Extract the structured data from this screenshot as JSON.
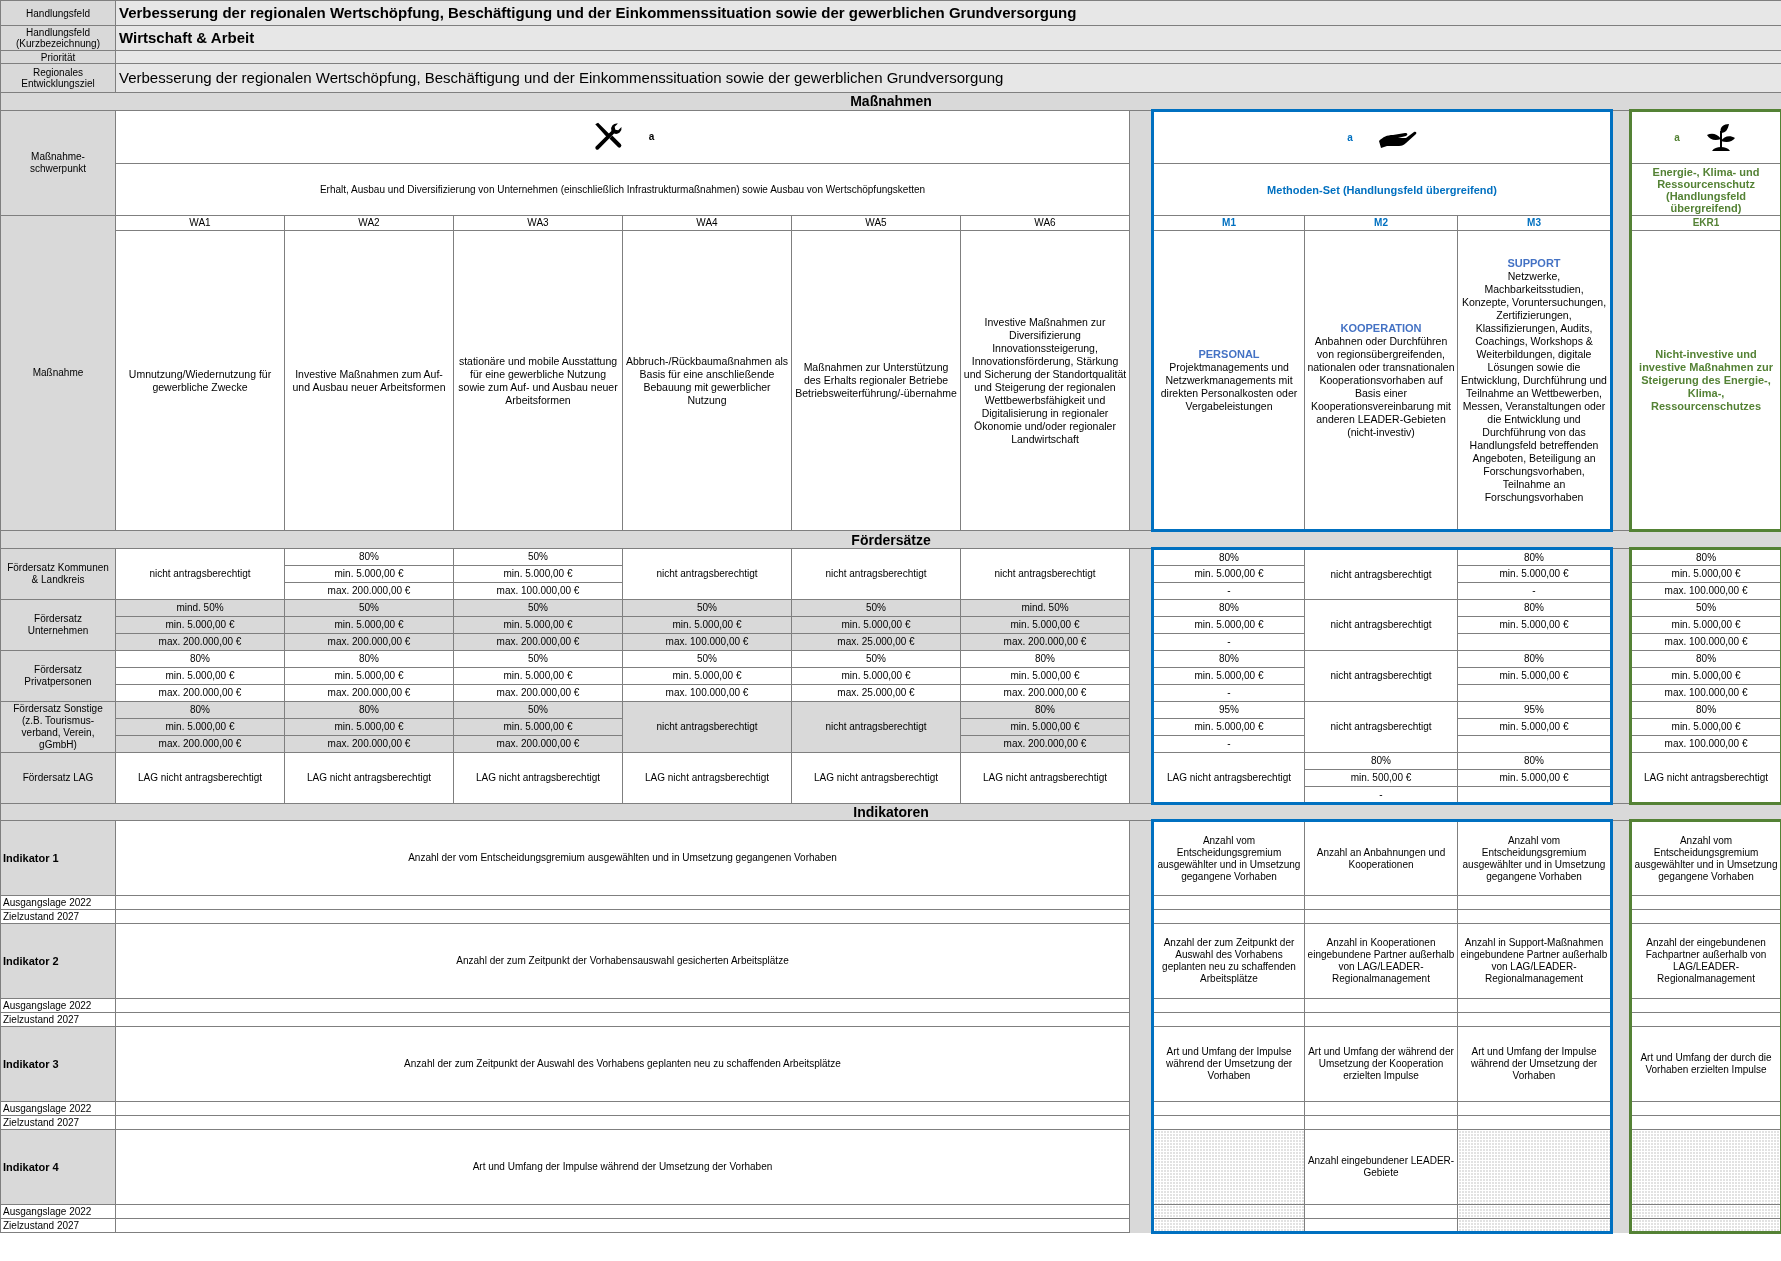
{
  "header": [
    {
      "label": "Handlungsfeld",
      "value": "Verbesserung der regionalen Wertschöpfung, Beschäftigung und der Einkommenssituation sowie der gewerblichen Grundversorgung",
      "bold": true
    },
    {
      "label": "Handlungsfeld (Kurzbezeichnung)",
      "value": "Wirtschaft & Arbeit",
      "bold": true
    },
    {
      "label": "Priorität"
    },
    {
      "label": "Regionales Entwicklungsziel",
      "value": "Verbesserung der regionalen Wertschöpfung, Beschäftigung und der Einkommenssituation sowie der gewerblichen Grundversorgung",
      "bold": false
    }
  ],
  "measures_section": {
    "title": "Maßnahmen",
    "focus_label": "Maßnahme-schwerpunkt",
    "measure_label": "Maßnahme",
    "groups": [
      {
        "kind": "main",
        "color": "#000000",
        "note": "a",
        "title": "Erhalt, Ausbau und Diversifizierung von Unternehmen (einschließlich Infrastrukturmaßnahmen) sowie Ausbau von Wertschöpfungsketten",
        "measures": [
          {
            "code": "WA1",
            "text": "Umnutzung/Wiedernutzung für gewerbliche Zwecke"
          },
          {
            "code": "WA2",
            "text": "Investive Maßnahmen zum Auf- und Ausbau neuer Arbeitsformen"
          },
          {
            "code": "WA3",
            "text": "stationäre und mobile Ausstattung für eine gewerbliche Nutzung sowie zum Auf- und Ausbau neuer Arbeitsformen"
          },
          {
            "code": "WA4",
            "text": "Abbruch-/Rückbaumaßnahmen als Basis für eine anschließende Bebauung mit gewerblicher Nutzung"
          },
          {
            "code": "WA5",
            "text": "Maßnahmen zur Unterstützung des Erhalts regionaler Betriebe Betriebsweiterführung/-übernahme"
          },
          {
            "code": "WA6",
            "text": "Investive Maßnahmen zur Diversifizierung Innovationssteigerung, Innovationsförderung, Stärkung und Sicherung der Standortqualität und Steigerung der regionalen Wettbewerbsfähigkeit und Digitalisierung in regionaler Ökonomie und/oder regionaler Landwirtschaft"
          }
        ]
      },
      {
        "kind": "methods",
        "color": "#0070c0",
        "note": "a",
        "title": "Methoden-Set (Handlungsfeld übergreifend)",
        "measures": [
          {
            "code": "M1",
            "heading": "PERSONAL",
            "text": "Projektmanagements und Netzwerkmanagements mit direkten Personalkosten oder Vergabeleistungen"
          },
          {
            "code": "M2",
            "heading": "KOOPERATION",
            "text": "Anbahnen oder Durchführen von regionsübergreifenden, nationalen oder transnationalen Kooperationsvorhaben auf Basis einer Kooperationsvereinbarung mit anderen LEADER-Gebieten (nicht-investiv)"
          },
          {
            "code": "M3",
            "heading": "SUPPORT",
            "text": "Netzwerke, Machbarkeitsstudien, Konzepte, Voruntersuchungen, Zertifizierungen, Klassifizierungen, Audits, Coachings, Workshops & Weiterbildungen, digitale Lösungen sowie die Entwicklung, Durchführung und Teilnahme an Wettbewerben, Messen, Veranstaltungen oder die Entwicklung und Durchführung von das Handlungsfeld betreffenden Angeboten, Beteiligung an Forschungsvorhaben, Teilnahme an Forschungsvorhaben"
          }
        ]
      },
      {
        "kind": "climate",
        "color": "#548235",
        "note": "a",
        "title": "Energie-, Klima- und Ressourcenschutz (Handlungsfeld übergreifend)",
        "measures": [
          {
            "code": "EKR1",
            "text": "Nicht-investive und investive Maßnahmen zur Steigerung des Energie-, Klima-, Ressourcenschutzes"
          }
        ]
      }
    ]
  },
  "funding": {
    "title": "Fördersätze",
    "rows": [
      {
        "label": "Fördersatz Kommunen & Landkreis",
        "shaded": false,
        "cells": [
          {
            "text": "nicht antragsberechtigt"
          },
          {
            "lines": [
              "80%",
              "min. 5.000,00 €",
              "max. 200.000,00 €"
            ]
          },
          {
            "lines": [
              "50%",
              "min. 5.000,00 €",
              "max. 100.000,00 €"
            ]
          },
          {
            "text": "nicht antragsberechtigt"
          },
          {
            "text": "nicht antragsberechtigt"
          },
          {
            "text": "nicht antragsberechtigt"
          },
          {
            "lines": [
              "80%",
              "min. 5.000,00 €",
              "-"
            ]
          },
          {
            "text": "nicht antragsberechtigt"
          },
          {
            "lines": [
              "80%",
              "min. 5.000,00 €",
              "-"
            ]
          },
          {
            "lines": [
              "80%",
              "min. 5.000,00 €",
              "max. 100.000,00 €"
            ]
          }
        ]
      },
      {
        "label": "Fördersatz Unternehmen",
        "shaded": true,
        "cells": [
          {
            "lines": [
              "mind. 50%",
              "min. 5.000,00 €",
              "max. 200.000,00 €"
            ]
          },
          {
            "lines": [
              "50%",
              "min. 5.000,00 €",
              "max. 200.000,00 €"
            ]
          },
          {
            "lines": [
              "50%",
              "min. 5.000,00 €",
              "max. 200.000,00 €"
            ]
          },
          {
            "lines": [
              "50%",
              "min. 5.000,00 €",
              "max. 100.000,00 €"
            ]
          },
          {
            "lines": [
              "50%",
              "min. 5.000,00 €",
              "max. 25.000,00 €"
            ]
          },
          {
            "lines": [
              "mind. 50%",
              "min. 5.000,00 €",
              "max. 200.000,00 €"
            ]
          },
          {
            "lines": [
              "80%",
              "min. 5.000,00 €",
              "-"
            ]
          },
          {
            "text": "nicht antragsberechtigt"
          },
          {
            "lines": [
              "80%",
              "min. 5.000,00 €"
            ]
          },
          {
            "lines": [
              "50%",
              "min. 5.000,00 €",
              "max. 100.000,00 €"
            ]
          }
        ]
      },
      {
        "label": "Fördersatz Privatpersonen",
        "shaded": false,
        "cells": [
          {
            "lines": [
              "80%",
              "min. 5.000,00 €",
              "max. 200.000,00 €"
            ]
          },
          {
            "lines": [
              "80%",
              "min. 5.000,00 €",
              "max. 200.000,00 €"
            ]
          },
          {
            "lines": [
              "50%",
              "min. 5.000,00 €",
              "max. 200.000,00 €"
            ]
          },
          {
            "lines": [
              "50%",
              "min. 5.000,00 €",
              "max. 100.000,00 €"
            ]
          },
          {
            "lines": [
              "50%",
              "min. 5.000,00 €",
              "max. 25.000,00 €"
            ]
          },
          {
            "lines": [
              "80%",
              "min. 5.000,00 €",
              "max. 200.000,00 €"
            ]
          },
          {
            "lines": [
              "80%",
              "min. 5.000,00 €",
              "-"
            ]
          },
          {
            "text": "nicht antragsberechtigt"
          },
          {
            "lines": [
              "80%",
              "min. 5.000,00 €"
            ]
          },
          {
            "lines": [
              "80%",
              "min. 5.000,00 €",
              "max. 100.000,00 €"
            ]
          }
        ]
      },
      {
        "label": "Fördersatz Sonstige (z.B. Tourismus-verband, Verein, gGmbH)",
        "shaded": true,
        "cells": [
          {
            "lines": [
              "80%",
              "min. 5.000,00 €",
              "max. 200.000,00 €"
            ]
          },
          {
            "lines": [
              "80%",
              "min. 5.000,00 €",
              "max. 200.000,00 €"
            ]
          },
          {
            "lines": [
              "50%",
              "min. 5.000,00 €",
              "max. 200.000,00 €"
            ]
          },
          {
            "text": "nicht antragsberechtigt"
          },
          {
            "text": "nicht antragsberechtigt"
          },
          {
            "lines": [
              "80%",
              "min. 5.000,00 €",
              "max. 200.000,00 €"
            ]
          },
          {
            "lines": [
              "95%",
              "min. 5.000,00 €",
              "-"
            ]
          },
          {
            "text": "nicht antragsberechtigt"
          },
          {
            "lines": [
              "95%",
              "min. 5.000,00 €"
            ]
          },
          {
            "lines": [
              "80%",
              "min. 5.000,00 €",
              "max. 100.000,00 €"
            ]
          }
        ]
      },
      {
        "label": "Fördersatz LAG",
        "shaded": false,
        "cells": [
          {
            "text": "LAG nicht antragsberechtigt"
          },
          {
            "text": "LAG nicht antragsberechtigt"
          },
          {
            "text": "LAG nicht antragsberechtigt"
          },
          {
            "text": "LAG nicht antragsberechtigt"
          },
          {
            "text": "LAG nicht antragsberechtigt"
          },
          {
            "text": "LAG nicht antragsberechtigt"
          },
          {
            "text": "LAG nicht antragsberechtigt"
          },
          {
            "lines": [
              "80%",
              "min. 500,00 €",
              "-"
            ]
          },
          {
            "lines": [
              "80%",
              "min. 5.000,00 €"
            ]
          },
          {
            "text": "LAG nicht antragsberechtigt"
          }
        ]
      }
    ]
  },
  "indicators": {
    "title": "Indikatoren",
    "items": [
      {
        "label": "Indikator 1",
        "text": "Anzahl der vom Entscheidungsgremium ausgewählten und in Umsetzung gegangenen Vorhaben",
        "baseline_label": "Ausgangslage 2022",
        "target_label": "Zielzustand 2027",
        "cells": [
          {
            "text": "Anzahl vom Entscheidungsgremium ausgewählter und in Umsetzung gegangene Vorhaben",
            "hatched": false
          },
          {
            "text": "Anzahl an Anbahnungen und Kooperationen",
            "hatched": false
          },
          {
            "text": "Anzahl vom Entscheidungsgremium ausgewählter und in Umsetzung gegangene Vorhaben",
            "hatched": false
          },
          {
            "text": "Anzahl vom Entscheidungsgremium ausgewählter und in Umsetzung gegangene Vorhaben",
            "hatched": false
          }
        ]
      },
      {
        "label": "Indikator 2",
        "text": "Anzahl der zum Zeitpunkt der Vorhabensauswahl gesicherten Arbeitsplätze",
        "baseline_label": "Ausgangslage 2022",
        "target_label": "Zielzustand 2027",
        "cells": [
          {
            "text": "Anzahl der zum Zeitpunkt der Auswahl des Vorhabens geplanten neu zu schaffenden Arbeitsplätze",
            "hatched": false
          },
          {
            "text": "Anzahl in Kooperationen eingebundene Partner außerhalb von LAG/LEADER-Regionalmanagement",
            "hatched": false
          },
          {
            "text": "Anzahl in Support-Maßnahmen eingebundene Partner außerhalb von LAG/LEADER-Regionalmanagement",
            "hatched": false
          },
          {
            "text": "Anzahl der eingebundenen Fachpartner außerhalb von LAG/LEADER-Regionalmanagement",
            "hatched": false
          }
        ]
      },
      {
        "label": "Indikator 3",
        "text": "Anzahl der zum Zeitpunkt der Auswahl des Vorhabens geplanten neu zu schaffenden Arbeitsplätze",
        "baseline_label": "Ausgangslage 2022",
        "target_label": "Zielzustand 2027",
        "cells": [
          {
            "text": "Art und Umfang der Impulse während der Umsetzung der Vorhaben",
            "hatched": false
          },
          {
            "text": "Art und Umfang der während der Umsetzung der Kooperation erzielten Impulse",
            "hatched": false
          },
          {
            "text": "Art und Umfang der Impulse während der Umsetzung der Vorhaben",
            "hatched": false
          },
          {
            "text": "Art und Umfang der durch die Vorhaben erzielten Impulse",
            "hatched": false
          }
        ]
      },
      {
        "label": "Indikator 4",
        "text": "Art und Umfang der Impulse während der Umsetzung der Vorhaben",
        "baseline_label": "Ausgangslage 2022",
        "target_label": "Zielzustand 2027",
        "cells": [
          {
            "hatched": true
          },
          {
            "text": "Anzahl eingebundener LEADER-Gebiete",
            "hatched": false
          },
          {
            "hatched": true
          },
          {
            "hatched": true
          }
        ]
      }
    ]
  }
}
